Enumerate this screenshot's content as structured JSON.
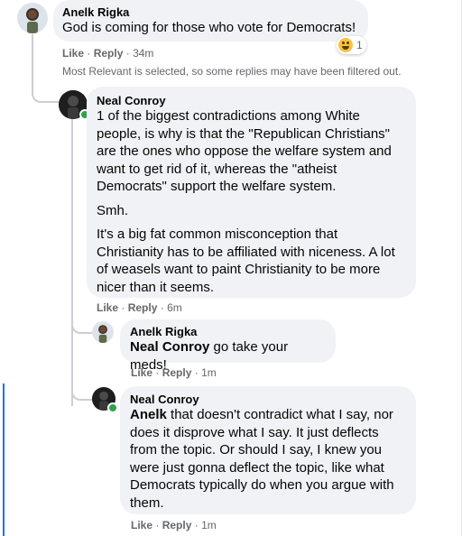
{
  "top_comment": {
    "author": "Anelk Rigka",
    "text": "God is coming for those who vote for Democrats!",
    "reaction_count": "1",
    "reaction_icon": "haha-reaction-icon",
    "like_label": "Like",
    "reply_label": "Reply",
    "time": "34m"
  },
  "filter_note": "Most Relevant is selected, so some replies may have been filtered out.",
  "replies": [
    {
      "author": "Neal Conroy",
      "paragraphs": [
        "1 of the biggest contradictions among White people, is why is that the \"Republican Christians\" are the ones who oppose the welfare system and want to get rid of it, whereas the \"atheist Democrats\" support the welfare system.",
        "Smh.",
        "It's a big fat common misconception that Christianity has to be affiliated with niceness. A lot of weasels want to paint Christianity to be more nicer than it seems."
      ],
      "like_label": "Like",
      "reply_label": "Reply",
      "time": "6m"
    },
    {
      "author": "Anelk Rigka",
      "mention": "Neal Conroy",
      "text": " go take your meds!",
      "like_label": "Like",
      "reply_label": "Reply",
      "time": "1m"
    },
    {
      "author": "Neal Conroy",
      "mention": "Anelk",
      "text": " that doesn't contradict what I say, nor does it disprove what I say. It just deflects from the topic. Or should I say, I knew you were just gonna deflect the topic, like what Democrats typically do when you argue with them.",
      "like_label": "Like",
      "reply_label": "Reply",
      "time": "1m"
    }
  ],
  "separator": "·",
  "colors": {
    "bubble": "#f0f2f5",
    "meta_text": "#65676b",
    "online": "#31a24c",
    "thread_line": "#ccced2"
  }
}
